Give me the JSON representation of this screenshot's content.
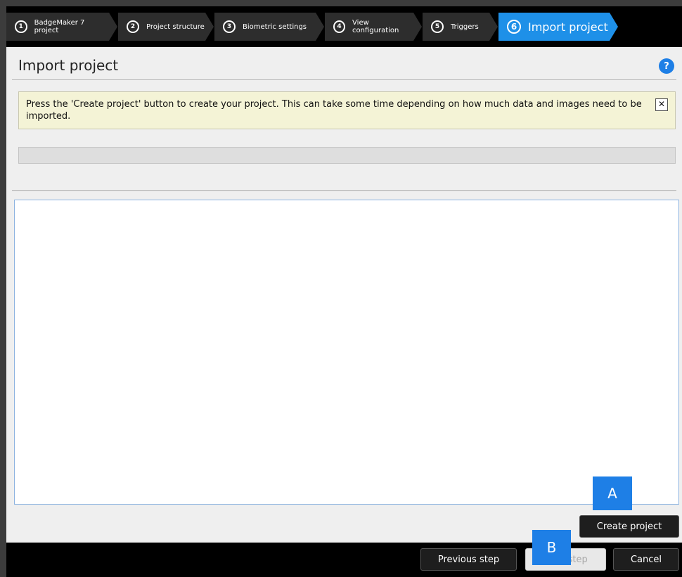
{
  "steps": [
    {
      "num": "1",
      "label": "BadgeMaker 7 project"
    },
    {
      "num": "2",
      "label": "Project structure"
    },
    {
      "num": "3",
      "label": "Biometric settings"
    },
    {
      "num": "4",
      "label": "View configuration"
    },
    {
      "num": "5",
      "label": "Triggers"
    },
    {
      "num": "6",
      "label": "Import project"
    }
  ],
  "page": {
    "title": "Import project",
    "help_label": "?",
    "info_message": "Press the 'Create project' button to create your project. This can take some time depending on how much data and images need to be imported.",
    "info_close": "✕"
  },
  "buttons": {
    "create_project": "Create project",
    "previous_step": "Previous step",
    "next_step": "Next step",
    "cancel": "Cancel"
  },
  "callouts": {
    "a": "A",
    "b": "B"
  },
  "colors": {
    "accent": "#1e90e8",
    "info_background": "#f4f3d6"
  }
}
